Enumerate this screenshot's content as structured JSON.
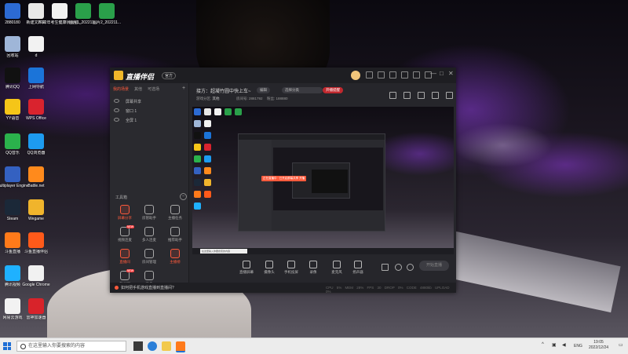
{
  "desktop_icons": [
    {
      "label": "2880180",
      "color": "#2c6ad3"
    },
    {
      "label": "新建文件夹",
      "color": "#e8e8e8"
    },
    {
      "label": "2022年考生健康状况监...",
      "color": "#f2f2f2"
    },
    {
      "label": "图片1_202211...",
      "color": "#2aa04a"
    },
    {
      "label": "图片2_202211...",
      "color": "#2aa04a"
    },
    {
      "label": "回收站",
      "color": "#9fb6d8"
    },
    {
      "label": "d",
      "color": "#f2f2f2"
    },
    {
      "label": "腾讯QQ",
      "color": "#111111"
    },
    {
      "label": "上网导航",
      "color": "#1b74d9"
    },
    {
      "label": "YY语音",
      "color": "#f5c518"
    },
    {
      "label": "WPS Office",
      "color": "#d9232e"
    },
    {
      "label": "QQ音乐",
      "color": "#2bb24c"
    },
    {
      "label": "QQ浏览器",
      "color": "#1d9bf0"
    },
    {
      "label": "Multiplayer Engine",
      "color": "#3461c1"
    },
    {
      "label": "Battle.net",
      "color": "#ff8a1c"
    },
    {
      "label": "Steam",
      "color": "#1b2838"
    },
    {
      "label": "Wegame",
      "color": "#f0b42c"
    },
    {
      "label": "斗鱼直播",
      "color": "#ff7a1a"
    },
    {
      "label": "斗鱼直播伴侣",
      "color": "#ff5a1a"
    },
    {
      "label": "腾讯视频",
      "color": "#1fb1ff"
    },
    {
      "label": "Google Chrome",
      "color": "#f1f1f1"
    },
    {
      "label": "网易云游戏",
      "color": "#f2f2f2"
    },
    {
      "label": "雷神加速器",
      "color": "#d8232a"
    }
  ],
  "window": {
    "title": "直播伴侣",
    "version_badge": "官方",
    "controls": {
      "minimize": "—",
      "maximize": "□",
      "close": "✕"
    }
  },
  "left_panel": {
    "tabs": [
      "我的场景",
      "其他",
      "可选场"
    ],
    "add": "+",
    "layers": [
      "屏幕共享",
      "窗口 1",
      "全屏 1"
    ],
    "toolbox_label": "工具箱",
    "toolbox_toggle": "–",
    "tools": [
      {
        "label": "屏幕分享",
        "red": true,
        "badge": ""
      },
      {
        "label": "房管助手",
        "red": false,
        "badge": ""
      },
      {
        "label": "主播任务",
        "red": false,
        "badge": ""
      },
      {
        "label": "视频连麦",
        "red": false,
        "badge": "NEW"
      },
      {
        "label": "多人连麦",
        "red": false,
        "badge": ""
      },
      {
        "label": "推荐助手",
        "red": false,
        "badge": ""
      },
      {
        "label": "直播间",
        "red": true,
        "badge": ""
      },
      {
        "label": "房间管理",
        "red": false,
        "badge": ""
      },
      {
        "label": "主播榜",
        "red": true,
        "badge": ""
      },
      {
        "label": "粉丝团",
        "red": false,
        "badge": "NEW"
      },
      {
        "label": "更多",
        "red": false,
        "badge": ""
      }
    ]
  },
  "stream": {
    "title": "接方：超凝竹圆中快上车~",
    "edit_title": "编辑",
    "edit_category": "选择分类",
    "notice": "开播提醒",
    "category_label": "游戏分区:",
    "category_value": "其他",
    "room_id": "房间号: 2881792",
    "fans": "粉丝: 188880"
  },
  "preview": {
    "overlay_banner": "正在直播中 · 已开启屏幕共享  开播",
    "search_text": "在这里输入你要搜索的内容"
  },
  "controls": [
    {
      "label": "直播屏幕"
    },
    {
      "label": "摄像头"
    },
    {
      "label": "手机投屏"
    },
    {
      "label": "录像"
    },
    {
      "label": "麦克风"
    },
    {
      "label": "扬声器"
    }
  ],
  "start_button": "开始直播",
  "bottom_bar": {
    "tip": "如何把手机游戏直播到直播间?",
    "stats": "CPU 5%  MEM 28%  FPS 30  DROP 0%  CODE 4880kb  UPLOAD 0%"
  },
  "taskbar": {
    "search_placeholder": "在这里输入你要搜索的内容",
    "lang": "ENG",
    "time": "19:05",
    "date": "2022/12/24"
  }
}
